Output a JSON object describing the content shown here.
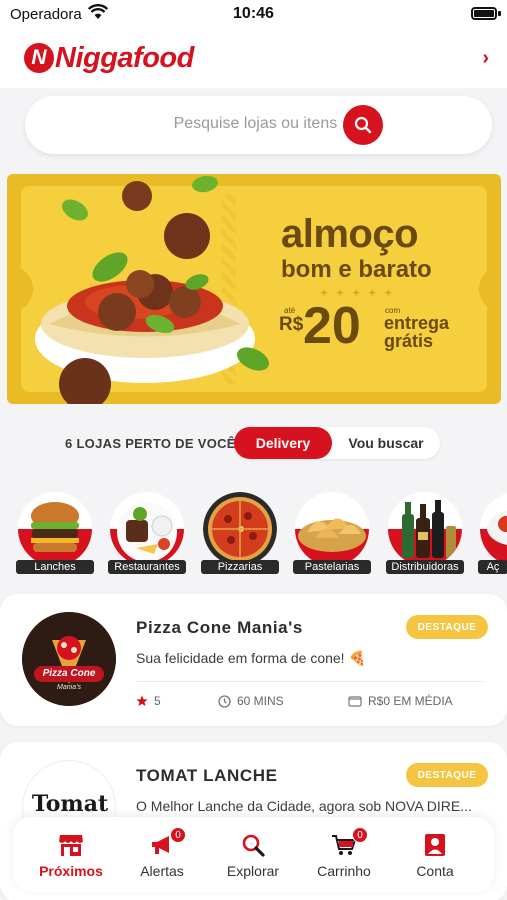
{
  "status_bar": {
    "carrier": "Operadora",
    "time": "10:46"
  },
  "header": {
    "brand": "Niggafood",
    "logo_letter": "N",
    "chevron": "›"
  },
  "search": {
    "placeholder": "Pesquise lojas ou itens ..."
  },
  "banner": {
    "line1": "almoço",
    "line2": "bom e barato",
    "dots": "✦✦✦✦✦",
    "prefix": "até",
    "currency": "R$",
    "price": "20",
    "suffix": "com",
    "delivery_line1": "entrega",
    "delivery_line2": "grátis"
  },
  "stores": {
    "count_label": "6 LOJAS PERTO DE VOCÊ",
    "mode_active": "Delivery",
    "mode_inactive": "Vou buscar"
  },
  "categories": [
    {
      "label": "Lanches",
      "icon": "burger-icon"
    },
    {
      "label": "Restaurantes",
      "icon": "plate-icon"
    },
    {
      "label": "Pizzarias",
      "icon": "pizza-icon"
    },
    {
      "label": "Pastelarias",
      "icon": "pastry-icon"
    },
    {
      "label": "Distribuidoras",
      "icon": "bottles-icon"
    },
    {
      "label": "Aç",
      "icon": "acai-icon"
    }
  ],
  "listings": [
    {
      "name": "Pizza Cone Mania's",
      "description": "Sua felicidade em forma de cone! 🍕",
      "badge": "DESTAQUE",
      "rating": "5",
      "time": "60 MINS",
      "price": "R$0 EM MÉDIA",
      "logo_text": "Pizza Cone",
      "logo_subtext": "Mania's"
    },
    {
      "name": "TOMAT LANCHE",
      "description": "O Melhor Lanche da Cidade, agora sob NOVA DIRE...",
      "badge": "DESTAQUE",
      "logo_text": "Tomat"
    }
  ],
  "tabbar": [
    {
      "label": "Próximos",
      "icon": "store-icon",
      "active": true
    },
    {
      "label": "Alertas",
      "icon": "megaphone-icon",
      "badge": "0"
    },
    {
      "label": "Explorar",
      "icon": "search-icon"
    },
    {
      "label": "Carrinho",
      "icon": "cart-icon",
      "badge": "0"
    },
    {
      "label": "Conta",
      "icon": "user-icon"
    }
  ],
  "colors": {
    "accent": "#d6121f",
    "banner_bg": "#f5cf3d",
    "banner_text": "#6a4a10",
    "badge": "#f5c542"
  }
}
